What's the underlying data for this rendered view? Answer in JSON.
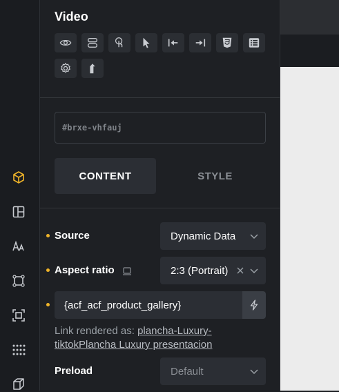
{
  "panel": {
    "title": "Video",
    "element_id": "#brxe-vhfauj"
  },
  "toolbar": {
    "buttons": [
      {
        "icon": "eye-icon"
      },
      {
        "icon": "toggle-icon"
      },
      {
        "icon": "pointer-touch-icon"
      },
      {
        "icon": "cursor-icon"
      },
      {
        "icon": "arrow-left-bar-icon"
      },
      {
        "icon": "arrow-right-bar-icon"
      },
      {
        "icon": "css3-icon"
      },
      {
        "icon": "list-icon"
      },
      {
        "icon": "gear-icon"
      },
      {
        "icon": "arrow-up-icon"
      }
    ]
  },
  "tabs": {
    "content": "CONTENT",
    "style": "STYLE"
  },
  "fields": {
    "source_label": "Source",
    "source_value": "Dynamic Data",
    "aspect_label": "Aspect ratio",
    "aspect_value": "2:3 (Portrait)",
    "dynamic_value": "{acf_acf_product_gallery}",
    "link_prefix": "Link rendered as: ",
    "link_value": "plancha-Luxury-tiktokPlancha Luxury presentacion",
    "preload_label": "Preload",
    "preload_value": "Default"
  },
  "sidebar": {
    "icons": [
      "cube-icon",
      "layout-icon",
      "typography-icon",
      "component-icon",
      "frame-icon",
      "grid-dots-icon",
      "box-icon"
    ]
  },
  "colors": {
    "accent": "#f0b429",
    "panel_bg": "#1e2024",
    "control_bg": "#2b2e34"
  }
}
